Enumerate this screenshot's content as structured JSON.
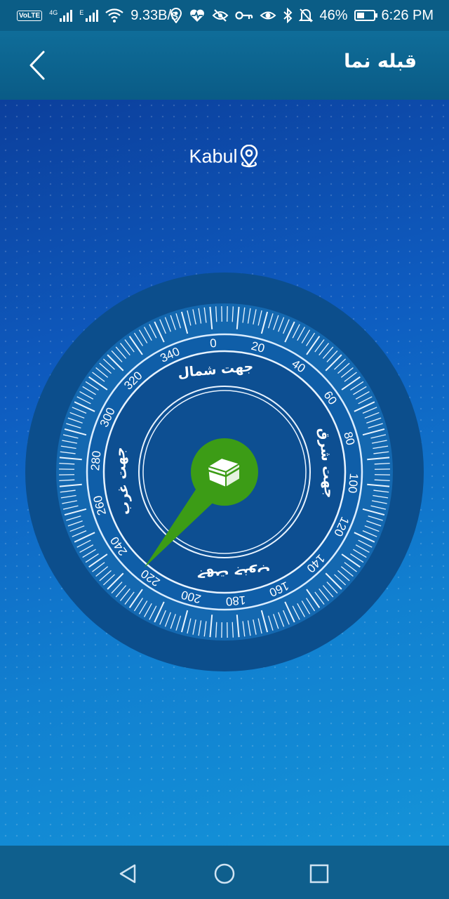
{
  "status_bar": {
    "volte": "VoLTE",
    "network1": "4G",
    "network2": "E",
    "speed": "9.33B/s",
    "battery_percent": "46%",
    "battery_level": 0.46,
    "time": "6:26 PM",
    "icons": [
      "location-icon",
      "heart-rate-icon",
      "eye-off-icon",
      "key-icon",
      "eye-icon",
      "bluetooth-icon",
      "bell-off-icon"
    ]
  },
  "app_bar": {
    "title": "قبله نما",
    "back_icon": "chevron-left-icon"
  },
  "location": {
    "city": "Kabul",
    "icon": "map-pin-icon"
  },
  "compass": {
    "degree_labels": [
      "0",
      "20",
      "40",
      "60",
      "80",
      "100",
      "120",
      "140",
      "160",
      "180",
      "200",
      "220",
      "240",
      "260",
      "280",
      "300",
      "320",
      "340"
    ],
    "north_label": "جهت شمال",
    "east_label": "جهت شرق",
    "south_label": "جهت جنوب",
    "west_label": "جهت غرب",
    "rotation_deg": -5,
    "qibla_bearing_deg": 225,
    "center_icon": "kaaba-icon",
    "colors": {
      "outer": "#0c4e8c",
      "dial": "#0f5ea8",
      "accent": "#3c9c16"
    }
  },
  "nav_bar": {
    "back_icon": "triangle-back-icon",
    "home_icon": "circle-home-icon",
    "recents_icon": "square-recents-icon"
  }
}
